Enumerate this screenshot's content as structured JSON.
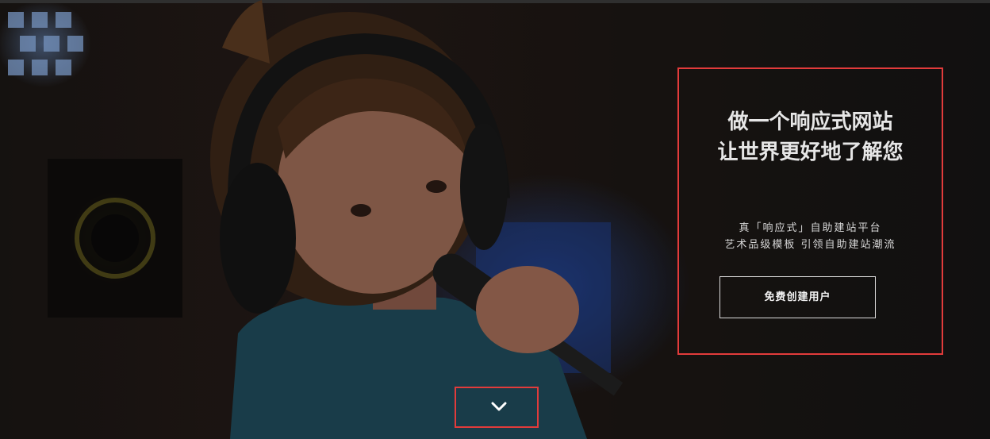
{
  "hero": {
    "headline_line1": "做一个响应式网站",
    "headline_line2": "让世界更好地了解您",
    "subline_line1": "真「响应式」自助建站平台",
    "subline_line2": "艺术品级模板 引领自助建站潮流",
    "cta_label": "免费创建用户",
    "scroll_icon": "chevron-down-icon",
    "highlight_color": "#e23b3b"
  }
}
